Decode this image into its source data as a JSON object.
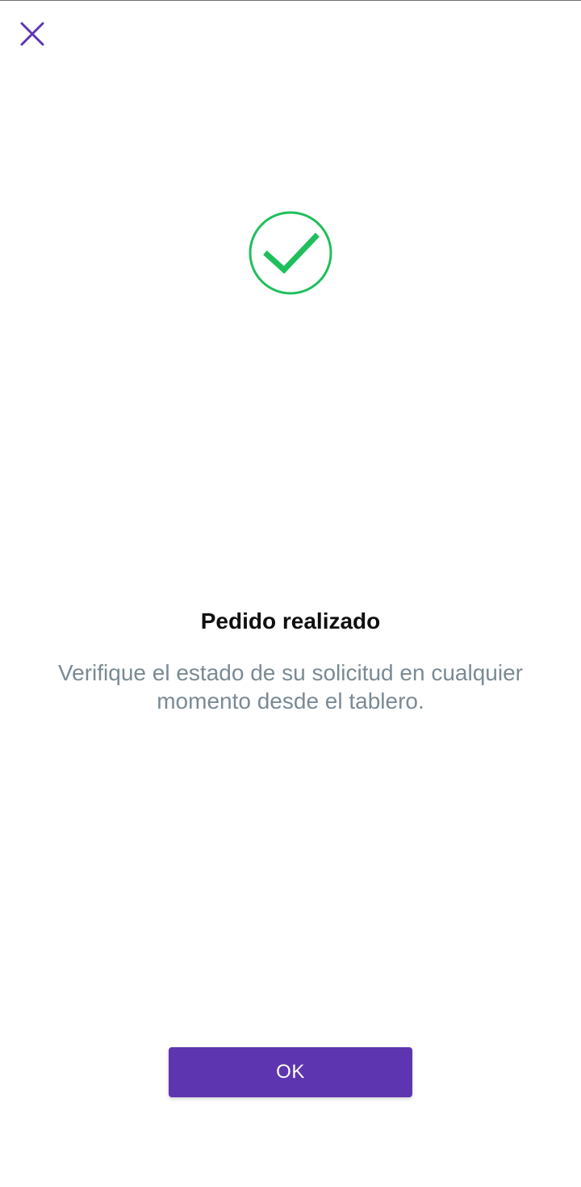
{
  "header": {
    "close_icon": "close-icon"
  },
  "status": {
    "icon": "check-circle-icon",
    "title": "Pedido realizado",
    "message": "Verifique el estado de su solicitud en cualquier momento desde el tablero."
  },
  "actions": {
    "ok_label": "OK"
  },
  "colors": {
    "accent": "#5e35b1",
    "success": "#1fbf5c",
    "message_text": "#7a8a94",
    "title_text": "#0f0f0f"
  }
}
